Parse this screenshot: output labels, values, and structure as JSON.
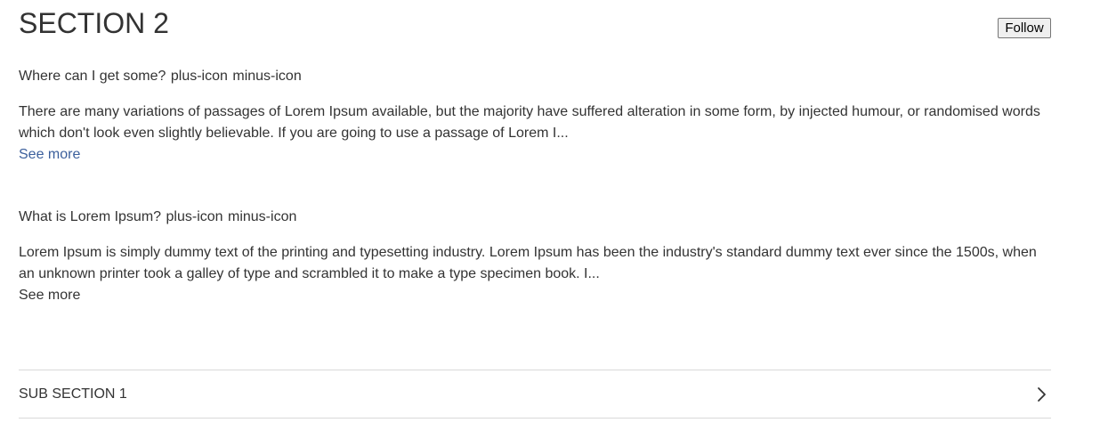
{
  "section": {
    "title": "SECTION 2",
    "follow_label": "Follow"
  },
  "faq": [
    {
      "question": "Where can I get some?",
      "plus_alt": "plus-icon",
      "minus_alt": "minus-icon",
      "answer": "There are many variations of passages of Lorem Ipsum available, but the majority have suffered alteration in some form, by injected humour, or randomised words which don't look even slightly believable. If you are going to use a passage of Lorem I...",
      "see_more": "See more"
    },
    {
      "question": "What is Lorem Ipsum?",
      "plus_alt": "plus-icon",
      "minus_alt": "minus-icon",
      "answer": "Lorem Ipsum is simply dummy text of the printing and typesetting industry. Lorem Ipsum has been the industry's standard dummy text ever since the 1500s, when an unknown printer took a galley of type and scrambled it to make a type specimen book. I...",
      "see_more": "See more"
    }
  ],
  "subsection": {
    "label": "SUB SECTION 1",
    "icon": "chevron-right-icon"
  },
  "colors": {
    "text": "#333333",
    "link": "#3b5f9c",
    "divider": "#d9d9d9"
  }
}
